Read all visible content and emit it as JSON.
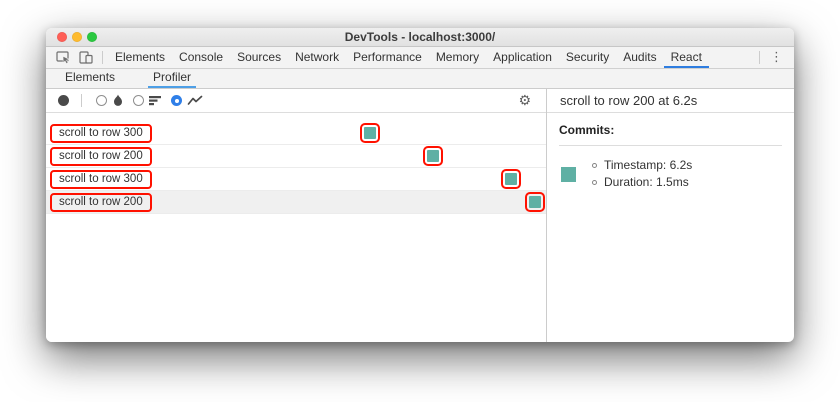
{
  "window": {
    "title": "DevTools - localhost:3000/"
  },
  "tabs": {
    "items": [
      "Elements",
      "Console",
      "Sources",
      "Network",
      "Performance",
      "Memory",
      "Application",
      "Security",
      "Audits",
      "React"
    ],
    "selected": "React"
  },
  "subtabs": {
    "items": [
      "Elements",
      "Profiler"
    ],
    "selected": "Profiler"
  },
  "toolbar": {
    "record_icon": "record-circle-icon",
    "view_options": [
      {
        "icon": "flame-icon",
        "selected": false
      },
      {
        "icon": "ranked-bars-icon",
        "selected": false
      },
      {
        "icon": "interactions-zigzag-icon",
        "selected": true
      }
    ],
    "settings_icon": "gear-icon"
  },
  "glyphs": {
    "kebab": "⋮",
    "gear": "⚙"
  },
  "interactions": {
    "rows": [
      {
        "label": "scroll to row 300",
        "selected": false
      },
      {
        "label": "scroll to row 200",
        "selected": false
      },
      {
        "label": "scroll to row 300",
        "selected": false
      },
      {
        "label": "scroll to row 200",
        "selected": true
      }
    ]
  },
  "right_panel": {
    "header": "scroll to row 200 at 6.2s",
    "commits_label": "Commits:",
    "commit": {
      "timestamp": "Timestamp: 6.2s",
      "duration": "Duration: 1.5ms"
    }
  },
  "colors": {
    "commit_teal": "#5fb0a4",
    "highlight_red": "#ff1100",
    "tab_accent_blue": "#2e7de0",
    "subtab_accent_blue": "#4d9fe6",
    "radio_accent_blue": "#2f7fe8",
    "selected_row_bg": "#f0f0f0",
    "traffic_red": "#ff5f57",
    "traffic_yellow": "#febb2e",
    "traffic_green": "#2bc840"
  }
}
